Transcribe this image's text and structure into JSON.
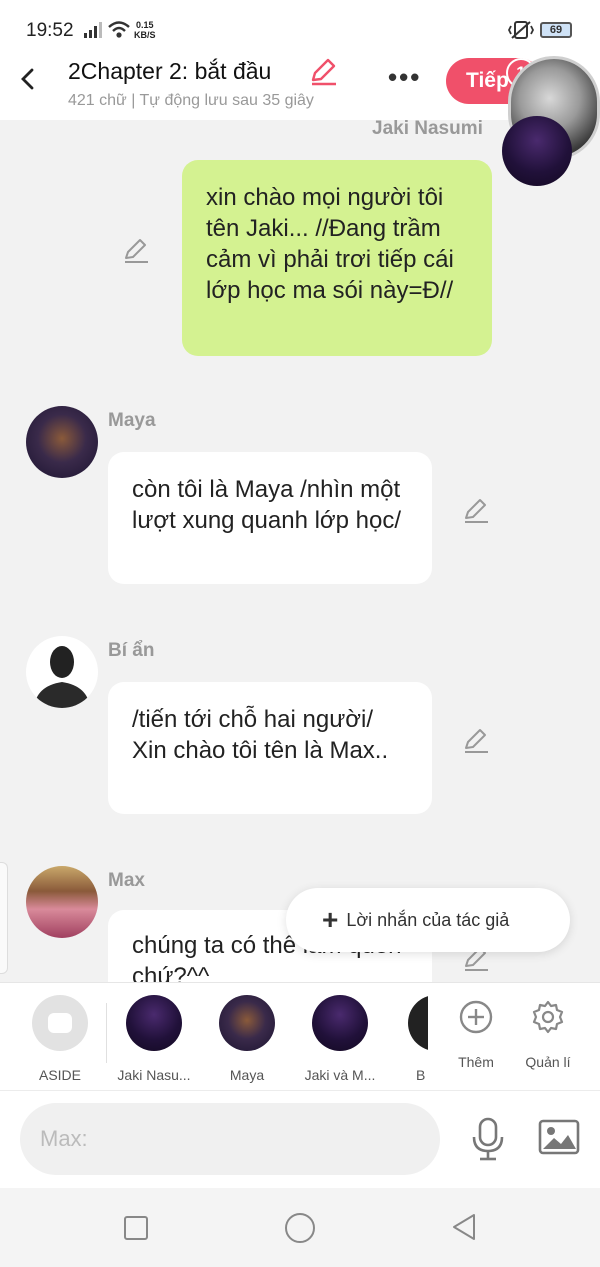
{
  "status": {
    "time": "19:52",
    "speed_value": "0.15",
    "speed_unit": "KB/S",
    "battery": "69"
  },
  "header": {
    "title": "2Chapter 2: bắt đầu",
    "subtitle": "421 chữ | Tự động lưu sau 35 giây",
    "next_label": "Tiếp",
    "badge": "1"
  },
  "messages": [
    {
      "speaker": "Jaki Nasumi",
      "text": "xin chào mọi người tôi tên Jaki... //Đang trầm cảm vì phải trơi tiếp cái lớp học ma sói này=Đ//"
    },
    {
      "speaker": "Maya",
      "text": "còn tôi là Maya /nhìn một lượt xung quanh lớp học/"
    },
    {
      "speaker": "Bí ẩn",
      "text": "/tiến tới chỗ hai người/ Xin chào tôi tên là Max.."
    },
    {
      "speaker": "Max",
      "text": "chúng ta có thể làm quen chứ?^^"
    }
  ],
  "author_note": {
    "label": "Lời nhắn của tác giả"
  },
  "characters": [
    {
      "label": "ASIDE"
    },
    {
      "label": "Jaki Nasu..."
    },
    {
      "label": "Maya"
    },
    {
      "label": "Jaki và M..."
    },
    {
      "label": "B"
    }
  ],
  "actions": {
    "add_label": "Thêm",
    "manage_label": "Quản lí"
  },
  "input": {
    "placeholder": "Max:"
  },
  "colors": {
    "accent": "#f0506a",
    "my_bubble": "#d4f291",
    "background": "#f2f2f2"
  }
}
